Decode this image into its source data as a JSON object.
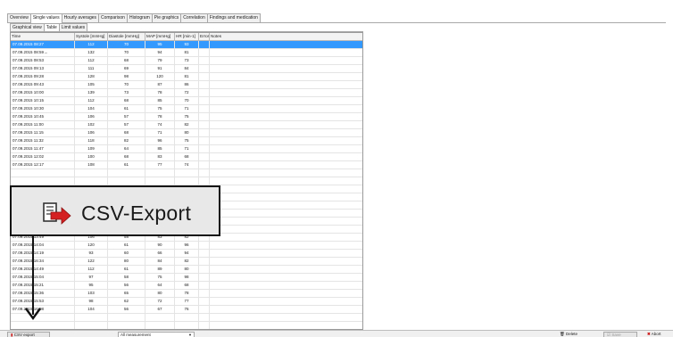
{
  "tabs": [
    "Overview",
    "Single values",
    "Hourly averages",
    "Comparison",
    "Histogram",
    "Pie graphics",
    "Correlation",
    "Findings and medication"
  ],
  "subtabs": [
    "Graphical view",
    "Table",
    "Limit values"
  ],
  "table": {
    "columns": [
      "Time",
      "Systole [mmHg]",
      "Diastole [mmHg]",
      "MAP [mmHg]",
      "HR [min-1]",
      "Error",
      "Notes"
    ],
    "rows": [
      [
        "07.09.2015  08:27",
        "112",
        "70",
        "95",
        "93",
        "",
        ""
      ],
      [
        "07.09.2015  08:59→",
        "132",
        "70",
        "94",
        "81",
        "",
        ""
      ],
      [
        "07.09.2015  08:53",
        "112",
        "68",
        "79",
        "73",
        "",
        ""
      ],
      [
        "07.09.2015  09:13",
        "111",
        "69",
        "91",
        "84",
        "",
        ""
      ],
      [
        "07.09.2015  09:28",
        "128",
        "98",
        "120",
        "81",
        "",
        ""
      ],
      [
        "07.09.2015  09:43",
        "105",
        "70",
        "87",
        "86",
        "",
        ""
      ],
      [
        "07.09.2015  10:00",
        "139",
        "73",
        "78",
        "72",
        "",
        ""
      ],
      [
        "07.09.2015  10:15",
        "112",
        "68",
        "85",
        "70",
        "",
        ""
      ],
      [
        "07.09.2015  10:30",
        "104",
        "61",
        "75",
        "71",
        "",
        ""
      ],
      [
        "07.09.2015  10:45",
        "106",
        "57",
        "78",
        "75",
        "",
        ""
      ],
      [
        "07.09.2015  11:00",
        "102",
        "57",
        "74",
        "82",
        "",
        ""
      ],
      [
        "07.09.2015  11:15",
        "106",
        "68",
        "71",
        "80",
        "",
        ""
      ],
      [
        "07.09.2015  11:32",
        "118",
        "82",
        "96",
        "75",
        "",
        ""
      ],
      [
        "07.09.2015  11:47",
        "109",
        "64",
        "85",
        "71",
        "",
        ""
      ],
      [
        "07.09.2015  12:02",
        "100",
        "68",
        "83",
        "68",
        "",
        ""
      ],
      [
        "07.09.2015  12:17",
        "108",
        "61",
        "77",
        "74",
        "",
        ""
      ],
      [
        "",
        "",
        "",
        "",
        "",
        "",
        ""
      ],
      [
        "",
        "",
        "",
        "",
        "",
        "",
        ""
      ],
      [
        "",
        "",
        "",
        "",
        "",
        "",
        ""
      ],
      [
        "",
        "",
        "",
        "",
        "",
        "",
        ""
      ],
      [
        "",
        "",
        "",
        "",
        "",
        "",
        ""
      ],
      [
        "",
        "",
        "",
        "",
        "",
        "",
        ""
      ],
      [
        "",
        "",
        "",
        "",
        "",
        "",
        ""
      ],
      [
        "",
        "",
        "",
        "",
        "",
        "",
        ""
      ],
      [
        "07.09.2015  13:49",
        "106",
        "58",
        "83",
        "82",
        "",
        ""
      ],
      [
        "07.09.2015  14:04",
        "120",
        "61",
        "90",
        "96",
        "",
        ""
      ],
      [
        "07.09.2015  14:19",
        "93",
        "60",
        "66",
        "94",
        "",
        ""
      ],
      [
        "07.09.2015  16:34",
        "122",
        "80",
        "84",
        "82",
        "",
        ""
      ],
      [
        "07.09.2015  14:49",
        "112",
        "61",
        "89",
        "80",
        "",
        ""
      ],
      [
        "07.09.2015  15:04",
        "97",
        "58",
        "75",
        "98",
        "",
        ""
      ],
      [
        "07.09.2015  15:21",
        "95",
        "56",
        "64",
        "68",
        "",
        ""
      ],
      [
        "07.09.2015  15:36",
        "103",
        "65",
        "80",
        "78",
        "",
        ""
      ],
      [
        "07.09.2015  15:53",
        "98",
        "62",
        "72",
        "77",
        "",
        ""
      ],
      [
        "07.09.2015  16:08",
        "104",
        "56",
        "67",
        "76",
        "",
        ""
      ],
      [
        "",
        "",
        "",
        "",
        "",
        "",
        ""
      ],
      [
        "",
        "",
        "",
        "",
        "",
        "",
        ""
      ],
      [
        "",
        "",
        "",
        "",
        "",
        "",
        ""
      ]
    ]
  },
  "bottom": {
    "csv_button": "CSV export",
    "dropdown_value": "All measurement",
    "delete": "Delete",
    "save": "Save",
    "abort": "Abort"
  },
  "callout": {
    "label": "CSV-Export"
  },
  "colors": {
    "selection": "#3399ff",
    "csv_icon": "#cc2222",
    "abort_icon": "#cc1111"
  },
  "icons": [
    "csv-export-icon",
    "trash-icon",
    "save-icon",
    "abort-x-icon",
    "down-arrow-icon"
  ]
}
